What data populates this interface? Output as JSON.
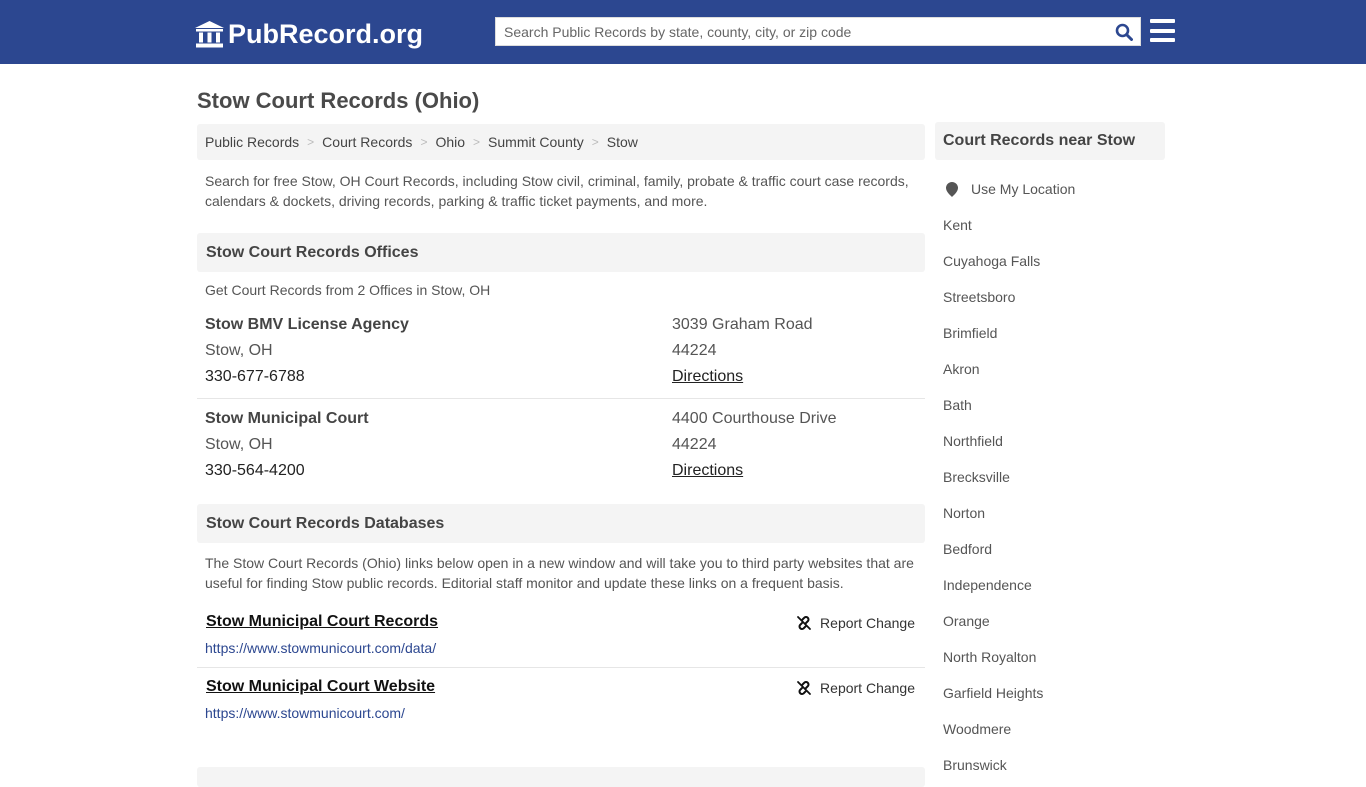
{
  "header": {
    "logo_text": "PubRecord.org",
    "logo_icon": "courthouse-icon",
    "search_placeholder": "Search Public Records by state, county, city, or zip code",
    "search_value": "",
    "search_icon": "search-icon",
    "menu_icon": "hamburger-menu-icon",
    "brand_color": "#2c4790"
  },
  "page": {
    "title": "Stow Court Records (Ohio)"
  },
  "breadcrumb": [
    {
      "label": "Public Records"
    },
    {
      "label": "Court Records"
    },
    {
      "label": "Ohio"
    },
    {
      "label": "Summit County"
    },
    {
      "label": "Stow"
    }
  ],
  "intro": "Search for free Stow, OH Court Records, including Stow civil, criminal, family, probate & traffic court case records, calendars & dockets, driving records, parking & traffic ticket payments, and more.",
  "offices_section": {
    "heading": "Stow Court Records Offices",
    "subtitle": "Get Court Records from 2 Offices in Stow, OH",
    "offices": [
      {
        "name": "Stow BMV License Agency",
        "city_state": "Stow, OH",
        "phone": "330-677-6788",
        "address": "3039 Graham Road",
        "zip": "44224",
        "directions_label": "Directions"
      },
      {
        "name": "Stow Municipal Court",
        "city_state": "Stow, OH",
        "phone": "330-564-4200",
        "address": "4400 Courthouse Drive",
        "zip": "44224",
        "directions_label": "Directions"
      }
    ]
  },
  "databases_section": {
    "heading": "Stow Court Records Databases",
    "description": "The Stow Court Records (Ohio) links below open in a new window and will take you to third party websites that are useful for finding Stow public records. Editorial staff monitor and update these links on a frequent basis.",
    "items": [
      {
        "title": "Stow Municipal Court Records",
        "url": "https://www.stowmunicourt.com/data/",
        "report_label": "Report Change"
      },
      {
        "title": "Stow Municipal Court Website",
        "url": "https://www.stowmunicourt.com/",
        "report_label": "Report Change"
      }
    ]
  },
  "sidebar": {
    "heading": "Court Records near Stow",
    "use_location_label": "Use My Location",
    "cities": [
      "Kent",
      "Cuyahoga Falls",
      "Streetsboro",
      "Brimfield",
      "Akron",
      "Bath",
      "Northfield",
      "Brecksville",
      "Norton",
      "Bedford",
      "Independence",
      "Orange",
      "North Royalton",
      "Garfield Heights",
      "Woodmere",
      "Brunswick"
    ]
  }
}
